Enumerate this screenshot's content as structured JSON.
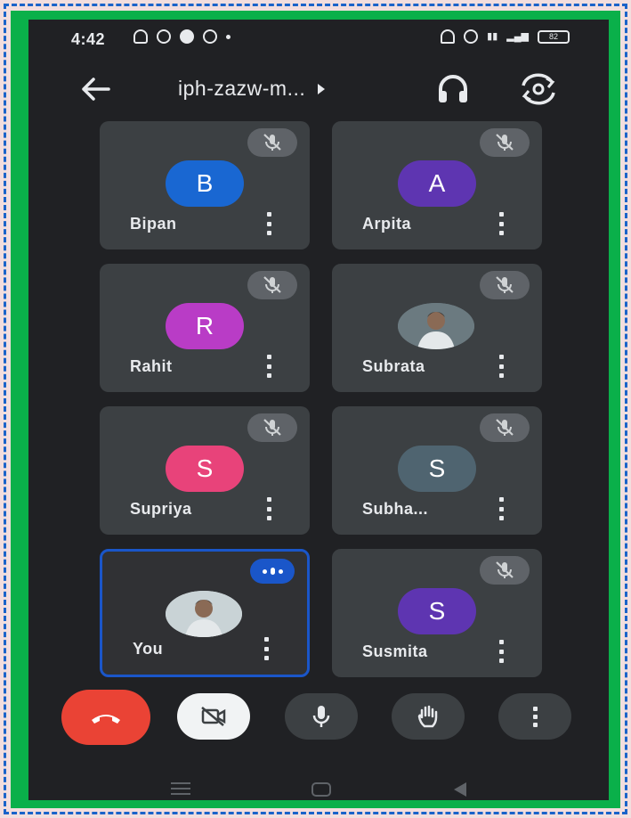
{
  "status_bar": {
    "time": "4:42",
    "left_icons": [
      "cloud-icon",
      "whatsapp-icon",
      "phone-icon",
      "messenger-icon",
      "dot-icon"
    ],
    "right_icons": [
      "headset-icon",
      "alarm-icon",
      "volte-icon",
      "signal-icon",
      "battery-icon"
    ],
    "battery": "82"
  },
  "top_bar": {
    "meeting_code": "iph-zazw-m...",
    "back_icon": "arrow-left-icon",
    "audio_icon": "headphones-icon",
    "switch_camera_icon": "flip-camera-icon"
  },
  "participants": [
    {
      "name": "Bipan",
      "initial": "B",
      "avatar_color": "#1967d2",
      "muted": true
    },
    {
      "name": "Arpita",
      "initial": "A",
      "avatar_color": "#5e35b1",
      "muted": true
    },
    {
      "name": "Rahit",
      "initial": "R",
      "avatar_color": "#b93cc6",
      "muted": true
    },
    {
      "name": "Subrata",
      "initial": "",
      "avatar_color": "#6b7a80",
      "muted": true,
      "photo": true
    },
    {
      "name": "Supriya",
      "initial": "S",
      "avatar_color": "#e8437a",
      "muted": true
    },
    {
      "name": "Subha...",
      "initial": "S",
      "avatar_color": "#4f6470",
      "muted": true
    },
    {
      "name": "You",
      "initial": "",
      "avatar_color": "#c9d3d6",
      "muted": false,
      "speaking": true,
      "photo": true
    },
    {
      "name": "Susmita",
      "initial": "S",
      "avatar_color": "#5e35b1",
      "muted": true
    }
  ],
  "controls": {
    "end_call_icon": "end-call-icon",
    "camera_icon": "camera-off-icon",
    "mic_icon": "microphone-icon",
    "raise_hand_icon": "raise-hand-icon",
    "more_icon": "more-vert-icon"
  },
  "colors": {
    "background": "#202124",
    "tile": "#3c4043",
    "end_call": "#ea4335",
    "self_border": "#1a56c9",
    "frame": "#0ab04a"
  }
}
